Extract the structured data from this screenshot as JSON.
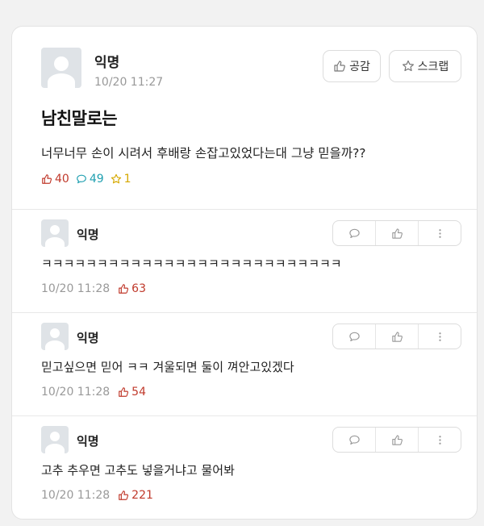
{
  "post": {
    "author": "익명",
    "time": "10/20 11:27",
    "like_button_label": "공감",
    "scrap_button_label": "스크랩",
    "title": "남친말로는",
    "body": "너무너무 손이 시려서 후배랑 손잡고있었다는대 그냥 믿을까??",
    "stats": {
      "likes": "40",
      "comments": "49",
      "scraps": "1"
    }
  },
  "comments": [
    {
      "author": "익명",
      "text": "ㅋㅋㅋㅋㅋㅋㅋㅋㅋㅋㅋㅋㅋㅋㅋㅋㅋㅋㅋㅋㅋㅋㅋㅋㅋㅋㅋ",
      "time": "10/20 11:28",
      "likes": "63"
    },
    {
      "author": "익명",
      "text": "믿고싶으면 믿어 ㅋㅋ 겨울되면 둘이 껴안고있겠다",
      "time": "10/20 11:28",
      "likes": "54"
    },
    {
      "author": "익명",
      "text": "고추 추우면 고추도 넣을거냐고 물어봐",
      "time": "10/20 11:28",
      "likes": "221"
    }
  ],
  "colors": {
    "like": "#c0392b",
    "comment": "#1e9fb0",
    "scrap": "#d6a800",
    "muted": "#999999"
  },
  "icons": {
    "like": "thumbs-up-icon",
    "comment": "speech-bubble-icon",
    "scrap": "star-icon",
    "more": "more-vertical-icon"
  }
}
